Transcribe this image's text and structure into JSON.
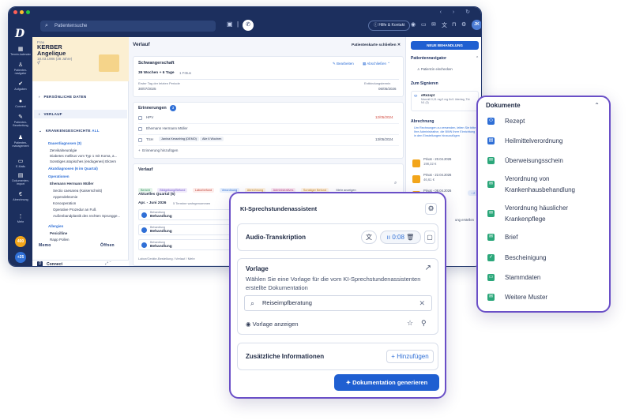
{
  "topbar": {
    "search_placeholder": "Patientensuche",
    "help_label": "Hilfe & Kontakt",
    "user_initials": "JK"
  },
  "sidenav": {
    "items": [
      {
        "label": "Termin-kalender"
      },
      {
        "label": "Patienten-navigator"
      },
      {
        "label": "Aufgaben"
      },
      {
        "label": "Connect"
      },
      {
        "label": "Patienten-Bearbeitung"
      },
      {
        "label": "Patienten-management"
      },
      {
        "label": "E-Mails"
      },
      {
        "label": "Dokumenten-import"
      },
      {
        "label": "Abrechnung"
      },
      {
        "label": "Mehr"
      }
    ],
    "badge_1": "400",
    "badge_2": "+25"
  },
  "patient": {
    "salutation": "Frau",
    "last_name": "KERBER",
    "first_name": "Angelique",
    "dob": "18.03.1986 (38 Jahre)",
    "sections": {
      "personal": "PERSÖNLICHE DATEN",
      "history_tab": "VERLAUF",
      "medical": "KRANKENGESCHICHTE",
      "medical_badge": "ALL"
    },
    "dauerdiagnosen": "Dauerdiagnosen (3)",
    "diag_1": "Zervikalneuralgie",
    "diag_2": "Diabetes mellitus vom Typ 1 mit Koma, a...",
    "diag_3": "Sonstiges atopisches (endogenes) Ekzem",
    "akut": "Akutdiagnosen (6 im Quartal)",
    "operationen": "Operationen",
    "op_doctor": "Ehemann Hermann Müller",
    "op_1": "Sectio caesarea (Kaiserschnitt)",
    "op_2": "Appendektomie",
    "op_3": "Konooperation",
    "op_4": "Operative Prozedur an Fuß",
    "op_5": "Außenbandplastik des rechten Sprungge...",
    "allergien": "Allergien",
    "allergy_1": "Penicilline",
    "allergy_2": "Rapp Pollen",
    "memo": "Memo",
    "open": "Öffnen",
    "connect": "Connect"
  },
  "main": {
    "title": "Verlauf",
    "close_card": "Patientenkarte schließen",
    "pregnancy": {
      "title": "Schwangerschaft",
      "edit": "Bearbeiten",
      "finish": "Abschließen",
      "weeks": "39 Wochen + 6 Tage",
      "fetus": "1 Fötus",
      "lmp_label": "Erster Tag der letzten Periode",
      "lmp": "30/07/2025",
      "due_label": "Entbindungstermin",
      "due": "06/05/2026"
    },
    "reminders": {
      "title": "Erinnerungen",
      "count": "3",
      "items": [
        {
          "label": "HPV",
          "date": "12/05/2024"
        },
        {
          "label": "Ehemann Hermann Müller",
          "date": ""
        },
        {
          "label": "TSH",
          "date": "13/05/2024"
        }
      ],
      "tsh_tag_1": "Janina Kesselring (DEMO)",
      "tsh_tag_2": "Alle 6 Wochen",
      "add": "Erinnerung hinzufügen"
    },
    "history": {
      "title": "Verlauf",
      "chips": [
        "Bericht",
        "Bildgebung/Befund",
        "Laborbefund",
        "Verordnung",
        "Abrechnung",
        "Administratives",
        "Sonstiger Befund",
        "Mehr anzeigen"
      ],
      "quarter": "Aktuelles Quartal (5)",
      "range": "Apr. - Juni 2026",
      "range_note": "5 Termine wahrgenommen",
      "entry_small": "Behandlung",
      "entry_title": "Behandlung",
      "footer": "Labor/Geräte-Bestellung / Verlauf / Mehr"
    }
  },
  "right": {
    "new_treatment": "NEUE BEHANDLUNG",
    "navigator": "Patientennavigator",
    "checkin": "Patient:in einchecken",
    "to_sign": "Zum Signieren",
    "erezept": "eRezept",
    "erezept_detail": "Maxmill 0,01 mg/1 mg 6x/1 übertag, Tbl. N1 (3)",
    "billing": "Abrechnung",
    "billing_text": "Um Rechnungen zu versenden, leiten Sie bitte Ihre Administrative, die BWN Ihrer Einrichtung in den Einstellungen hinzuzufügen",
    "invoices": [
      {
        "label": "Privat - 20.04.2026",
        "amount": "198,32 €"
      },
      {
        "label": "Privat - 22.04.2026",
        "amount": "46,61 €"
      },
      {
        "label": "Privat - 08.04.2026",
        "amount": "57,51 €"
      }
    ],
    "create": "ung erstellen"
  },
  "ki": {
    "title": "KI-Sprechstundenassistent",
    "audio_title": "Audio-Transkription",
    "timer": "0:08",
    "vorlage_title": "Vorlage",
    "vorlage_desc": "Wählen Sie eine Vorlage für die vom KI-Sprechstundenassistenten erstellte Dokumentation",
    "search_value": "Reiseimpfberatung",
    "show_template": "Vorlage anzeigen",
    "extra_title": "Zusätzliche Informationen",
    "add": "Hinzufügen",
    "generate": "Dokumentation generieren"
  },
  "dokumente": {
    "title": "Dokumente",
    "items": [
      {
        "label": "Rezept",
        "icon": "pills-icon"
      },
      {
        "label": "Heilmittelverordnung",
        "icon": "clipboard-icon"
      },
      {
        "label": "Überweisungsschein",
        "icon": "envelope-icon"
      },
      {
        "label": "Verordnung von Krankenhausbehandlung",
        "icon": "envelope-icon"
      },
      {
        "label": "Verordnung häuslicher Krankenpflege",
        "icon": "envelope-icon"
      },
      {
        "label": "Brief",
        "icon": "envelope-icon"
      },
      {
        "label": "Bescheinigung",
        "icon": "stamp-icon"
      },
      {
        "label": "Stammdaten",
        "icon": "print-icon"
      },
      {
        "label": "Weitere Muster",
        "icon": "envelope-icon"
      }
    ]
  },
  "colors": {
    "navy": "#1c2f5e",
    "primary": "#1f5fd1",
    "accent_border": "#6a4fc7",
    "doc_green": "#2ba77a"
  }
}
